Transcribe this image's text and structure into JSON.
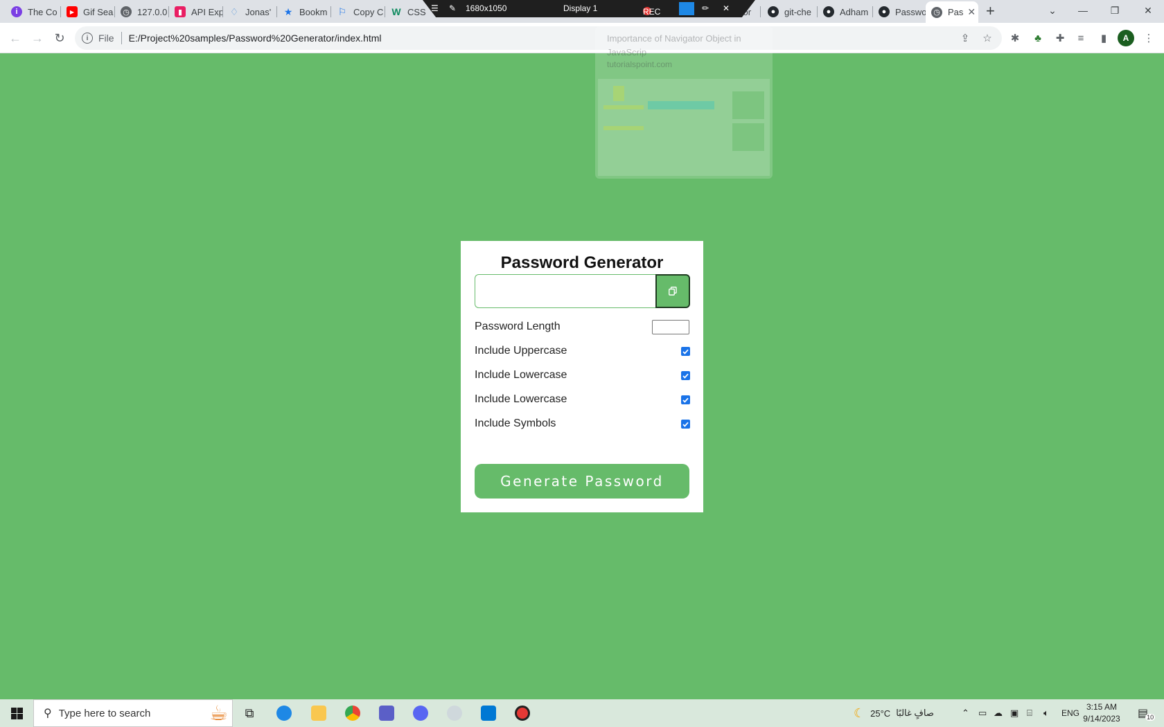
{
  "browser": {
    "tabs": [
      {
        "title": "The Co",
        "icon": "circle-i-icon",
        "color": "#7b3fe4"
      },
      {
        "title": "Gif Sea",
        "icon": "youtube-icon",
        "color": "#ff0000"
      },
      {
        "title": "127.0.0",
        "icon": "globe-icon",
        "color": "#5f6368"
      },
      {
        "title": "API Exp",
        "icon": "bookmark-icon",
        "color": "#e91e63"
      },
      {
        "title": "Jonas'",
        "icon": "diamond-icon",
        "color": "#4a90d9"
      },
      {
        "title": "Bookm",
        "icon": "star-icon",
        "color": "#1a73e8"
      },
      {
        "title": "Copy C",
        "icon": "flag-icon",
        "color": "#1a73e8"
      },
      {
        "title": "CSS",
        "icon": "w-icon",
        "color": "#0e8a5f"
      },
      {
        "title": "Jor",
        "icon": "globe-icon",
        "color": "#5f6368"
      },
      {
        "title": "git-che",
        "icon": "github-icon",
        "color": "#24292e"
      },
      {
        "title": "Adham",
        "icon": "github-icon",
        "color": "#24292e"
      },
      {
        "title": "Passwo",
        "icon": "github-icon",
        "color": "#24292e"
      },
      {
        "title": "Pas",
        "icon": "globe-icon",
        "color": "#5f6368",
        "active": true
      }
    ],
    "url_scheme_label": "File",
    "url": "E:/Project%20samples/Password%20Generator/index.html",
    "avatar_letter": "A"
  },
  "recorder": {
    "resolution": "1680x1050",
    "display": "Display 1",
    "rec_label": "REC"
  },
  "hover_card": {
    "title": "Importance of Navigator Object in JavaScrip",
    "domain": "tutorialspoint.com"
  },
  "app": {
    "title": "Password Generator",
    "password_value": "",
    "length_label": "Password Length",
    "length_value": "",
    "options": [
      {
        "label": "Include Uppercase",
        "checked": true
      },
      {
        "label": "Include Lowercase",
        "checked": true
      },
      {
        "label": "Include Lowercase",
        "checked": true
      },
      {
        "label": "Include Symbols",
        "checked": true
      }
    ],
    "generate_label": "Generate Password",
    "accent": "#66bb6a"
  },
  "taskbar": {
    "search_placeholder": "Type here to search",
    "weather": "25°C",
    "weather_text": "صافٍ غالبًا",
    "language": "ENG",
    "time": "3:15 AM",
    "date": "9/14/2023",
    "notifications": "10"
  }
}
